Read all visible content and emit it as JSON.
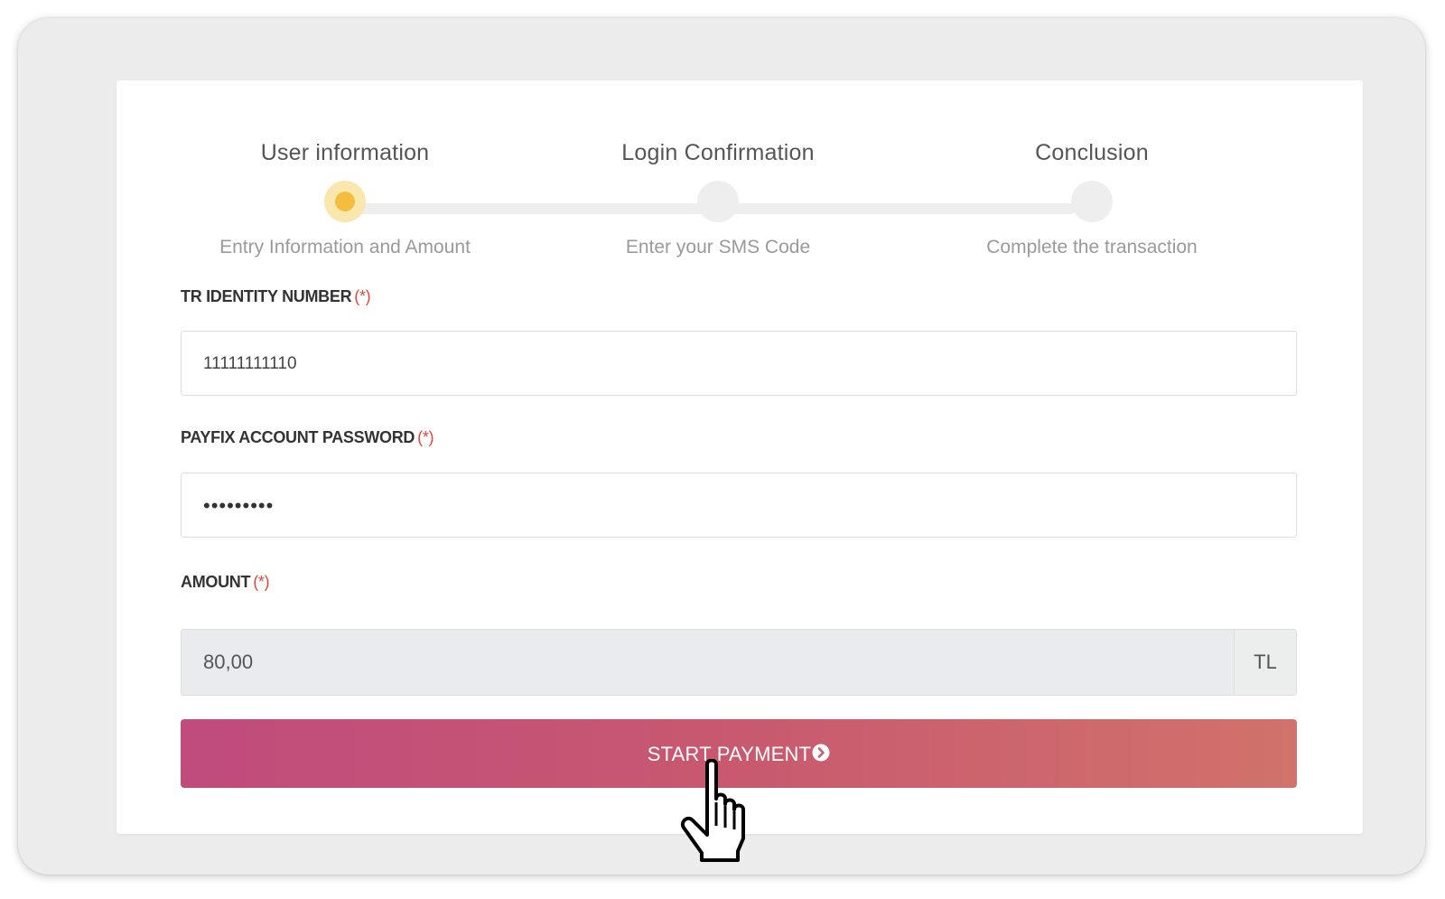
{
  "stepper": {
    "steps": [
      {
        "title": "User information",
        "subtitle": "Entry Information and Amount",
        "active": true
      },
      {
        "title": "Login Confirmation",
        "subtitle": "Enter your SMS Code",
        "active": false
      },
      {
        "title": "Conclusion",
        "subtitle": "Complete the transaction",
        "active": false
      }
    ]
  },
  "form": {
    "identity": {
      "label": "TR IDENTITY NUMBER",
      "required_mark": "(*)",
      "value": "11111111110"
    },
    "password": {
      "label": "PAYFIX ACCOUNT PASSWORD",
      "required_mark": "(*)",
      "value": "•••••••••"
    },
    "amount": {
      "label": "AMOUNT",
      "required_mark": "(*)",
      "value": "80,00",
      "currency": "TL"
    },
    "submit_label": "START PAYMENT"
  },
  "colors": {
    "active_step": "#f3be3e",
    "button_start": "#c04b7d",
    "button_end": "#d1726b",
    "required": "#e0473a"
  },
  "icons": {
    "submit": "chevron-circle-right-icon",
    "cursor": "hand-pointer-icon"
  }
}
